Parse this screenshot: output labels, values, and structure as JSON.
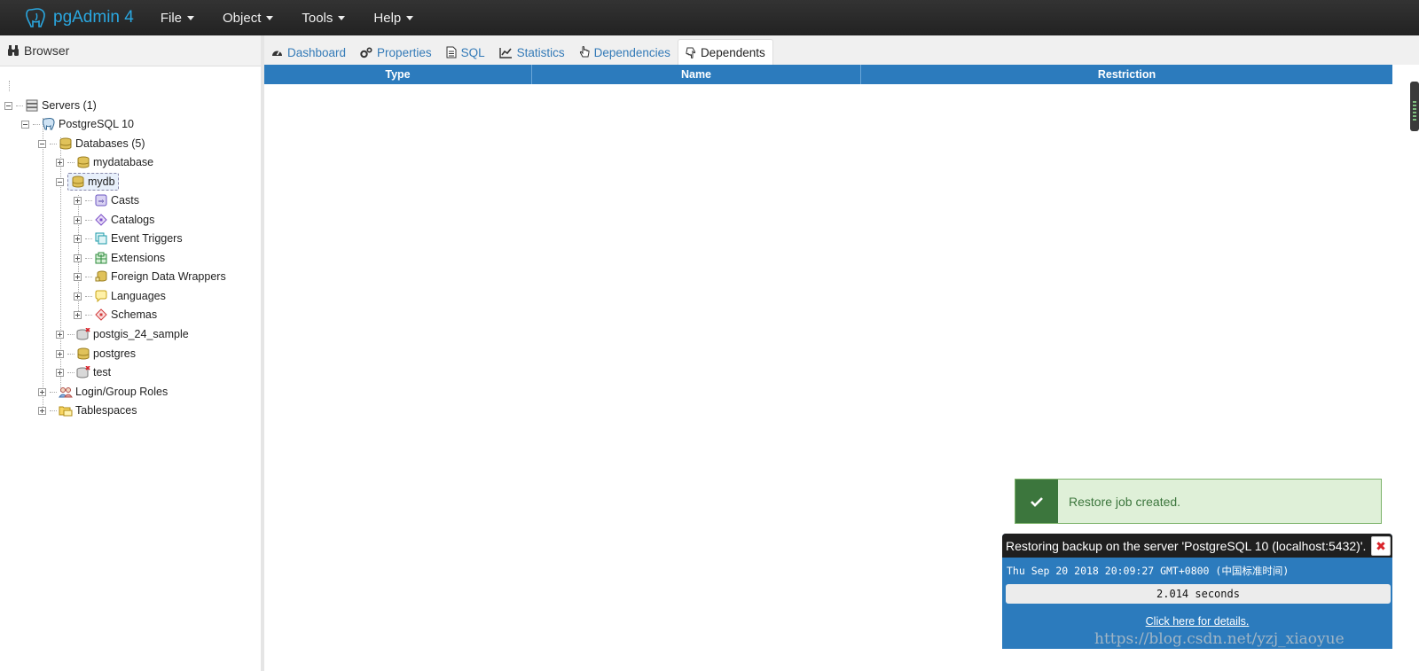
{
  "navbar": {
    "brand": "pgAdmin 4",
    "menu": [
      "File",
      "Object",
      "Tools",
      "Help"
    ]
  },
  "browser": {
    "title": "Browser",
    "tree": {
      "servers": "Servers (1)",
      "server": "PostgreSQL 10",
      "databases": "Databases (5)",
      "db1": "mydatabase",
      "db2": "mydb",
      "casts": "Casts",
      "catalogs": "Catalogs",
      "event_triggers": "Event Triggers",
      "extensions": "Extensions",
      "fdw": "Foreign Data Wrappers",
      "languages": "Languages",
      "schemas": "Schemas",
      "db3": "postgis_24_sample",
      "db4": "postgres",
      "db5": "test",
      "roles": "Login/Group Roles",
      "tablespaces": "Tablespaces"
    }
  },
  "tabs": [
    "Dashboard",
    "Properties",
    "SQL",
    "Statistics",
    "Dependencies",
    "Dependents"
  ],
  "grid": {
    "columns": [
      "Type",
      "Name",
      "Restriction"
    ]
  },
  "alert": {
    "message": "Restore job created."
  },
  "job": {
    "title": "Restoring backup on the server 'PostgreSQL 10 (localhost:5432)'.",
    "time": "Thu Sep 20 2018 20:09:27 GMT+0800 (中国标准时间)",
    "elapsed": "2.014 seconds",
    "details_link": "Click here for details."
  },
  "watermark": "https://blog.csdn.net/yzj_xiaoyue",
  "colors": {
    "accent": "#2c7bbd",
    "brand": "#2aa7e0",
    "success": "#3c763d"
  }
}
